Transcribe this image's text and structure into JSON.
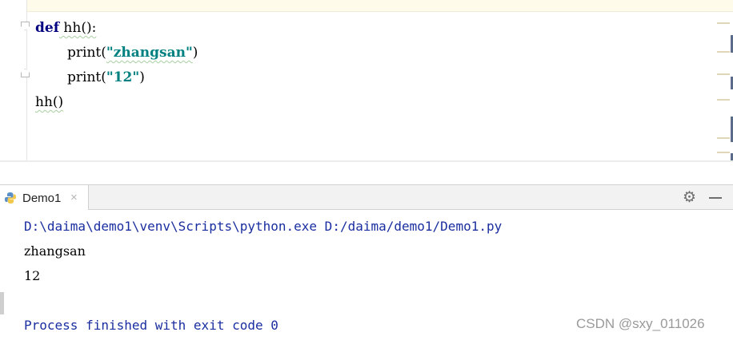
{
  "editor": {
    "lines": [
      {
        "keyword": "def",
        "rest": " hh():"
      },
      {
        "func": "print(",
        "string": "\"zhangsan\"",
        "close": ")"
      },
      {
        "func": "print(",
        "string": "\"12\"",
        "close": ")"
      },
      {
        "text": "hh()"
      }
    ]
  },
  "run_panel": {
    "tab_label": "Demo1",
    "close_glyph": "×",
    "settings_icon": "gear-icon",
    "minimize_icon": "minimize-icon",
    "console": {
      "command": "D:\\daima\\demo1\\venv\\Scripts\\python.exe D:/daima/demo1/Demo1.py",
      "output": [
        "zhangsan",
        "12"
      ],
      "exit_message": "Process finished with exit code 0"
    }
  },
  "watermark": "CSDN @sxy_011026",
  "colors": {
    "keyword": "#000080",
    "string": "#008080",
    "console_blue": "#1a2ea0"
  }
}
